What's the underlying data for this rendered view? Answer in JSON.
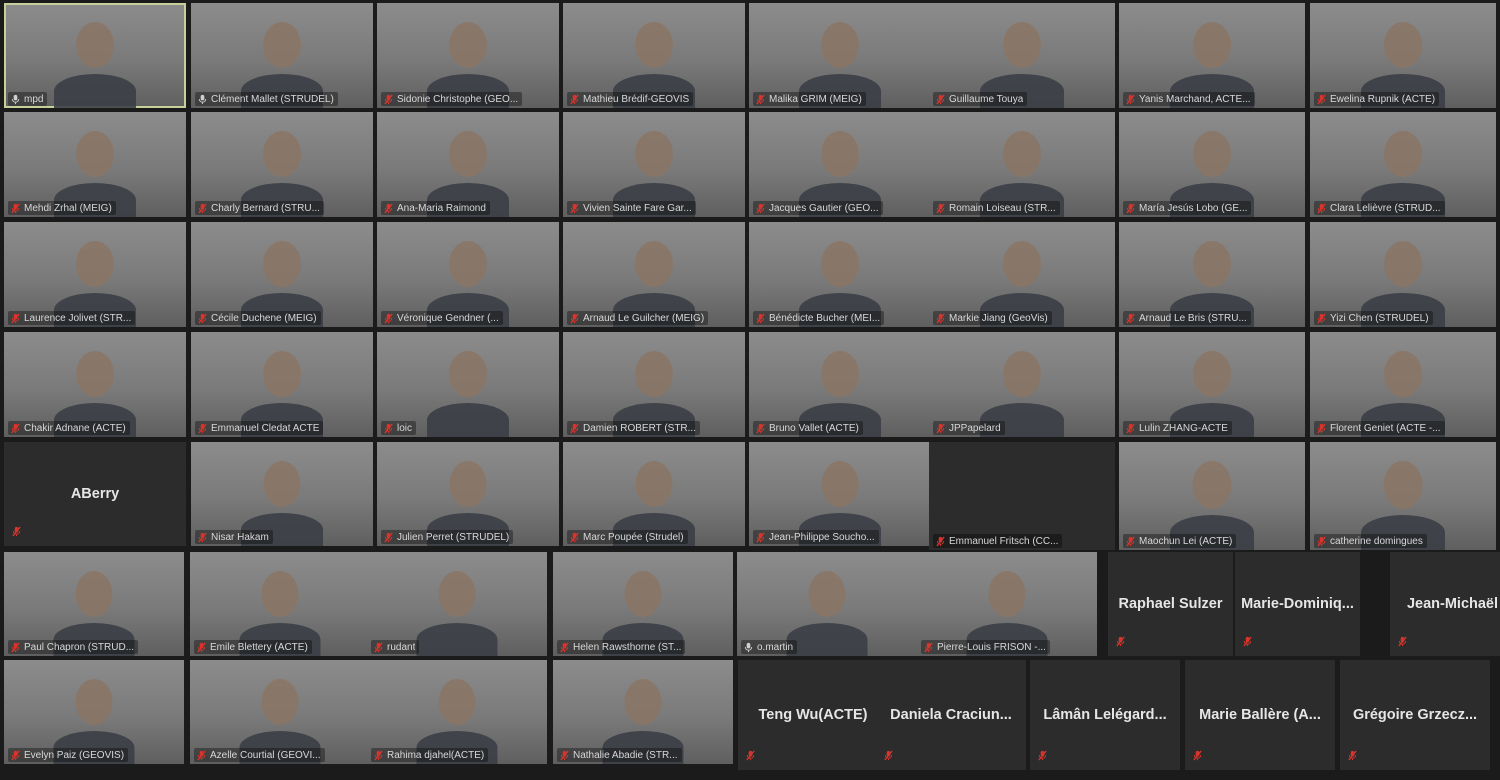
{
  "participants": [
    {
      "name": "mpd",
      "type": "video",
      "muted": false,
      "active": true
    },
    {
      "name": "Clément Mallet (STRUDEL)",
      "type": "video",
      "muted": false
    },
    {
      "name": "Sidonie Christophe (GEO...",
      "type": "video",
      "muted": true
    },
    {
      "name": "Mathieu Brédif-GEOVIS",
      "type": "video",
      "muted": true
    },
    {
      "name": "Malika GRIM (MEIG)",
      "type": "video",
      "muted": true
    },
    {
      "name": "Guillaume Touya",
      "type": "video",
      "muted": true
    },
    {
      "name": "Yanis Marchand, ACTE...",
      "type": "video",
      "muted": true
    },
    {
      "name": "Ewelina Rupnik (ACTE)",
      "type": "video",
      "muted": true
    },
    {
      "name": "Mehdi Zrhal (MEIG)",
      "type": "video",
      "muted": true
    },
    {
      "name": "Charly Bernard (STRU...",
      "type": "video",
      "muted": true
    },
    {
      "name": "Ana-Maria Raimond",
      "type": "video",
      "muted": true
    },
    {
      "name": "Vivien Sainte Fare Gar...",
      "type": "video",
      "muted": true
    },
    {
      "name": "Jacques Gautier (GEO...",
      "type": "video",
      "muted": true
    },
    {
      "name": "Romain Loiseau (STR...",
      "type": "video",
      "muted": true
    },
    {
      "name": "María Jesús Lobo (GE...",
      "type": "video",
      "muted": true
    },
    {
      "name": "Clara Lelièvre (STRUD...",
      "type": "video",
      "muted": true
    },
    {
      "name": "Laurence Jolivet (STR...",
      "type": "video",
      "muted": true
    },
    {
      "name": "Cécile Duchene (MEIG)",
      "type": "video",
      "muted": true
    },
    {
      "name": "Véronique Gendner (...",
      "type": "video",
      "muted": true
    },
    {
      "name": "Arnaud Le Guilcher (MEIG)",
      "type": "video",
      "muted": true
    },
    {
      "name": "Bénédicte Bucher (MEI...",
      "type": "video",
      "muted": true
    },
    {
      "name": "Markie Jiang (GeoVis)",
      "type": "video",
      "muted": true
    },
    {
      "name": "Arnaud Le Bris (STRU...",
      "type": "video",
      "muted": true
    },
    {
      "name": "Yizi Chen (STRUDEL)",
      "type": "video",
      "muted": true
    },
    {
      "name": "Chakir Adnane (ACTE)",
      "type": "video",
      "muted": true
    },
    {
      "name": "Emmanuel Cledat ACTE",
      "type": "video",
      "muted": true
    },
    {
      "name": "loic",
      "type": "video",
      "muted": true
    },
    {
      "name": "Damien ROBERT (STR...",
      "type": "video",
      "muted": true
    },
    {
      "name": "Bruno Vallet (ACTE)",
      "type": "video",
      "muted": true
    },
    {
      "name": "JPPapelard",
      "type": "video",
      "muted": true
    },
    {
      "name": "Lulin ZHANG-ACTE",
      "type": "video",
      "muted": true
    },
    {
      "name": "Florent Geniet (ACTE -...",
      "type": "video",
      "muted": true
    },
    {
      "name": "ABerry",
      "type": "name",
      "muted": true
    },
    {
      "name": "Nisar Hakam",
      "type": "video",
      "muted": true
    },
    {
      "name": "Julien Perret (STRUDEL)",
      "type": "video",
      "muted": true
    },
    {
      "name": "Marc Poupée (Strudel)",
      "type": "video",
      "muted": true
    },
    {
      "name": "Jean-Philippe Soucho...",
      "type": "video",
      "muted": true
    },
    {
      "name": "Emmanuel Fritsch (CC...",
      "type": "blank",
      "muted": true
    },
    {
      "name": "Maochun Lei (ACTE)",
      "type": "video",
      "muted": true
    },
    {
      "name": "catherine domingues",
      "type": "video",
      "muted": true
    },
    {
      "name": "Paul Chapron (STRUD...",
      "type": "video",
      "muted": true
    },
    {
      "name": "Emile Blettery (ACTE)",
      "type": "video",
      "muted": true
    },
    {
      "name": "rudant",
      "type": "video",
      "muted": true
    },
    {
      "name": "Helen Rawsthorne (ST...",
      "type": "video",
      "muted": true
    },
    {
      "name": "o.martin",
      "type": "video",
      "muted": false
    },
    {
      "name": "Pierre-Louis FRISON -...",
      "type": "video",
      "muted": true
    },
    {
      "name": "Raphael Sulzer",
      "type": "name",
      "muted": true
    },
    {
      "name": "Marie-Dominiq...",
      "type": "name",
      "muted": true
    },
    {
      "name": "Jean-Michaël",
      "type": "name",
      "muted": true
    },
    {
      "name": "Evelyn Paiz (GEOVIS)",
      "type": "video",
      "muted": true
    },
    {
      "name": "Azelle Courtial (GEOVI...",
      "type": "video",
      "muted": true
    },
    {
      "name": "Rahima djahel(ACTE)",
      "type": "video",
      "muted": true
    },
    {
      "name": "Nathalie Abadie (STR...",
      "type": "video",
      "muted": true
    },
    {
      "name": "Teng Wu(ACTE)",
      "type": "name",
      "muted": true
    },
    {
      "name": "Daniela Craciun...",
      "type": "name",
      "muted": true
    },
    {
      "name": "Lâmân Lelégard...",
      "type": "name",
      "muted": true
    },
    {
      "name": "Marie Ballère (A...",
      "type": "name",
      "muted": true
    },
    {
      "name": "Grégoire Grzecz...",
      "type": "name",
      "muted": true
    }
  ],
  "colors": {
    "muted_icon": "#d9342b",
    "normal_icon": "#cfcfcf",
    "active_border": "#c6d09a"
  }
}
